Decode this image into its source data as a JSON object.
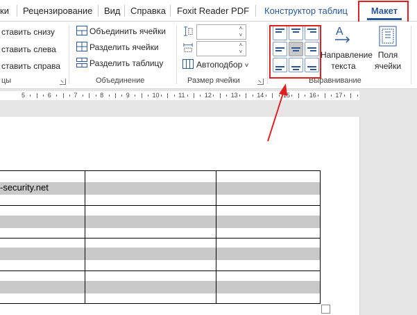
{
  "tabs": {
    "cut_left": "ки",
    "review": "Рецензирование",
    "view": "Вид",
    "help": "Справка",
    "foxit": "Foxit Reader PDF",
    "table_design": "Конструктор таблиц",
    "layout": "Макет"
  },
  "rows_columns": {
    "insert_below": "ставить снизу",
    "insert_left": "ставить слева",
    "insert_right": "ставить справа",
    "group_label": "цы"
  },
  "merge": {
    "merge_cells": "Объединить ячейки",
    "split_cells": "Разделить ячейки",
    "split_table": "Разделить таблицу",
    "group_label": "Объединение"
  },
  "cell_size": {
    "height_value": "",
    "width_value": "",
    "autofit": "Автоподбор",
    "group_label": "Размер ячейки"
  },
  "alignment": {
    "text_direction_line1": "Направление",
    "text_direction_line2": "текста",
    "cell_margins_line1": "Поля",
    "cell_margins_line2": "ячейки",
    "group_label": "Выравнивание",
    "selected_button": "center-left"
  },
  "ruler": {
    "numbers": [
      "5",
      "6",
      "7",
      "8",
      "9",
      "10",
      "11",
      "12",
      "13",
      "14",
      "15",
      "16",
      "17"
    ]
  },
  "document": {
    "cell_text": "-security.net"
  },
  "colors": {
    "accent": "#2b579a",
    "highlight_red": "#e02020",
    "row_shading": "#c9c9c9"
  }
}
